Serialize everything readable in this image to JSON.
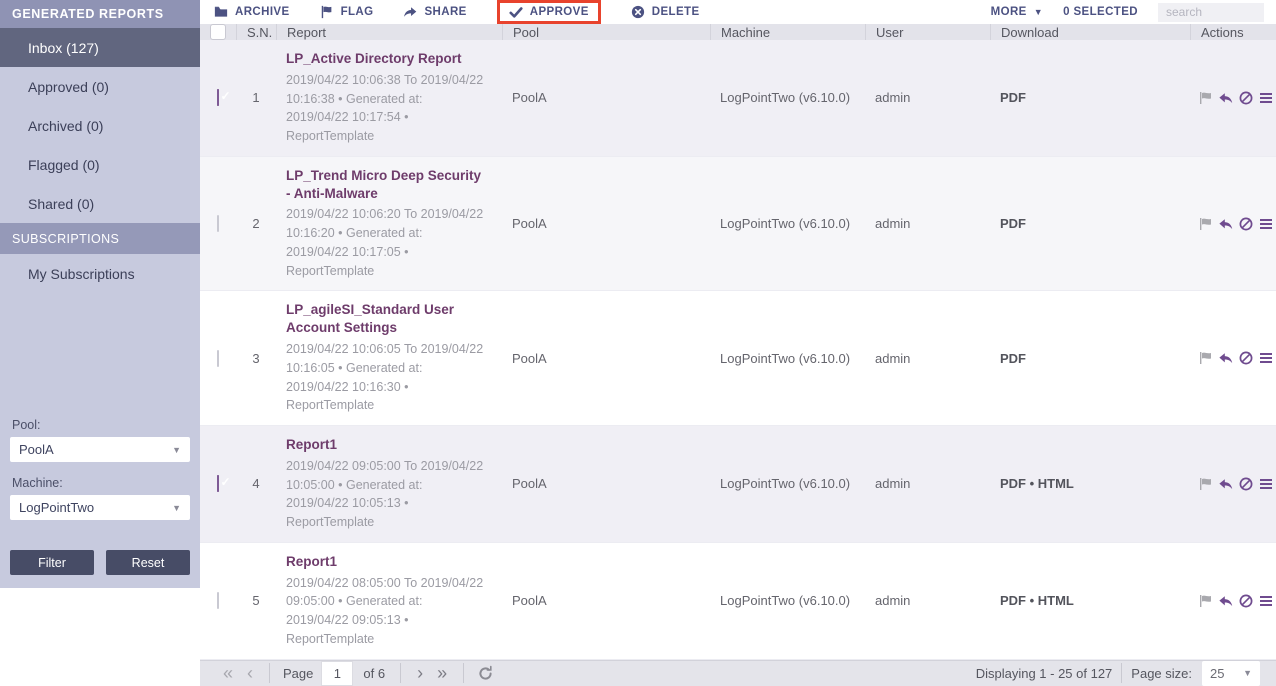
{
  "sidebar": {
    "title": "GENERATED REPORTS",
    "items": [
      {
        "label": "Inbox (127)",
        "active": true
      },
      {
        "label": "Approved (0)",
        "active": false
      },
      {
        "label": "Archived (0)",
        "active": false
      },
      {
        "label": "Flagged (0)",
        "active": false
      },
      {
        "label": "Shared (0)",
        "active": false
      }
    ],
    "section_title": "SUBSCRIPTIONS",
    "subscription_item": "My Subscriptions",
    "filters": {
      "pool_label": "Pool:",
      "pool_value": "PoolA",
      "machine_label": "Machine:",
      "machine_value": "LogPointTwo",
      "filter_button": "Filter",
      "reset_button": "Reset"
    }
  },
  "toolbar": {
    "archive": "ARCHIVE",
    "flag": "FLAG",
    "share": "SHARE",
    "approve": "APPROVE",
    "delete": "DELETE",
    "more": "MORE",
    "selected_count": "0 SELECTED",
    "search_placeholder": "search",
    "approve_highlight_color": "#e8432d"
  },
  "table": {
    "columns": [
      "S.N.",
      "Report",
      "Pool",
      "Machine",
      "User",
      "Download",
      "Actions"
    ],
    "rows": [
      {
        "sn": "1",
        "checked": true,
        "title": "LP_Active Directory Report",
        "meta": "2019/04/22 10:06:38 To 2019/04/22 10:16:38 • Generated at: 2019/04/22 10:17:54 • ReportTemplate",
        "pool": "PoolA",
        "machine": "LogPointTwo (v6.10.0)",
        "user": "admin",
        "download": "PDF"
      },
      {
        "sn": "2",
        "checked": false,
        "title": "LP_Trend Micro Deep Security - Anti-Malware",
        "meta": "2019/04/22 10:06:20 To 2019/04/22 10:16:20 • Generated at: 2019/04/22 10:17:05 • ReportTemplate",
        "pool": "PoolA",
        "machine": "LogPointTwo (v6.10.0)",
        "user": "admin",
        "download": "PDF"
      },
      {
        "sn": "3",
        "checked": false,
        "title": "LP_agileSI_Standard User Account Settings",
        "meta": "2019/04/22 10:06:05 To 2019/04/22 10:16:05 • Generated at: 2019/04/22 10:16:30 • ReportTemplate",
        "pool": "PoolA",
        "machine": "LogPointTwo (v6.10.0)",
        "user": "admin",
        "download": "PDF"
      },
      {
        "sn": "4",
        "checked": true,
        "title": "Report1",
        "meta": "2019/04/22 09:05:00 To 2019/04/22 10:05:00 • Generated at: 2019/04/22 10:05:13 • ReportTemplate",
        "pool": "PoolA",
        "machine": "LogPointTwo (v6.10.0)",
        "user": "admin",
        "download": "PDF • HTML"
      },
      {
        "sn": "5",
        "checked": false,
        "title": "Report1",
        "meta": "2019/04/22 08:05:00 To 2019/04/22 09:05:00 • Generated at: 2019/04/22 09:05:13 • ReportTemplate",
        "pool": "PoolA",
        "machine": "LogPointTwo (v6.10.0)",
        "user": "admin",
        "download": "PDF • HTML"
      }
    ],
    "action_icons": [
      "flag-icon",
      "reply-icon",
      "block-icon",
      "list-icon"
    ]
  },
  "footer": {
    "page_label": "Page",
    "page_value": "1",
    "of_label": "of 6",
    "displaying": "Displaying 1 - 25 of 127",
    "page_size_label": "Page size:",
    "page_size_value": "25"
  },
  "colors": {
    "sidebar_bg": "#c7cade",
    "sidebar_header_bg": "#8f93b4",
    "active_item_bg": "#61667f",
    "toolbar_text": "#4c5282",
    "title_purple": "#6e3c6b",
    "action_icon_purple": "#6f4b8f",
    "approve_outline": "#e8432d",
    "selected_row_bg": "#f0eff5"
  }
}
